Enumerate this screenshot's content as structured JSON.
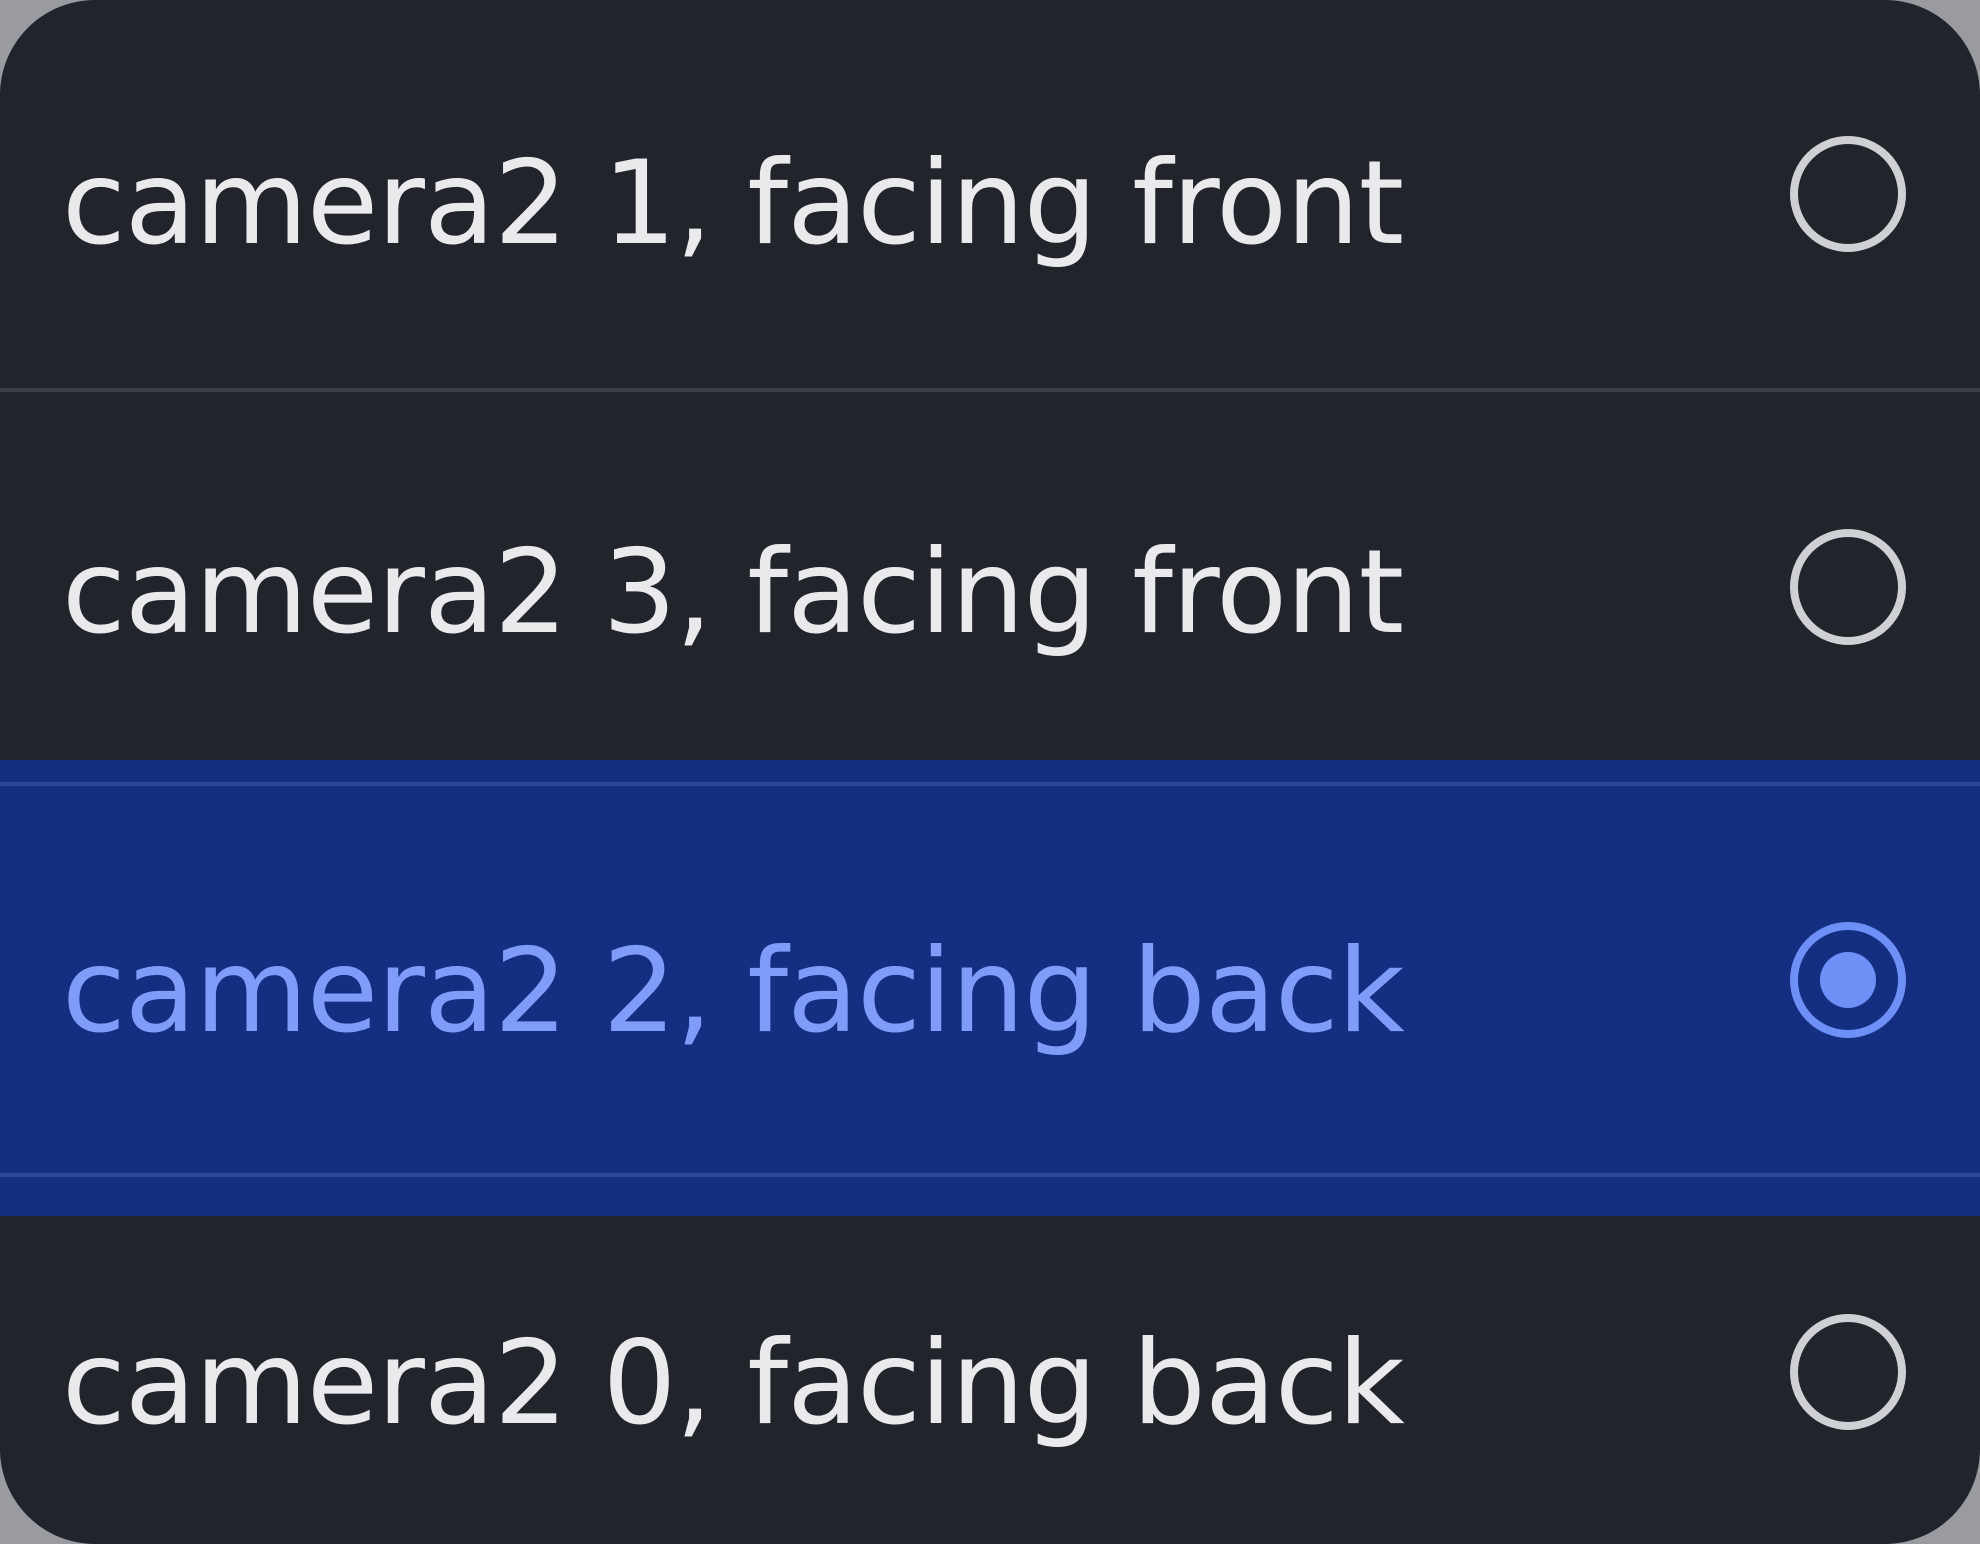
{
  "camera_options": [
    {
      "label": "camera2 1, facing front",
      "selected": false
    },
    {
      "label": "camera2 3, facing front",
      "selected": false
    },
    {
      "label": "camera2 2, facing back",
      "selected": true
    },
    {
      "label": "camera2 0, facing back",
      "selected": false
    }
  ],
  "colors": {
    "panel_background": "#22242c",
    "selected_background": "#142e82",
    "selected_accent": "#6e8ff6",
    "text": "#eaeaec",
    "radio_outline": "#cfd0d4"
  },
  "icons": {
    "unselected": "radio-unchecked-icon",
    "selected": "radio-checked-icon"
  }
}
